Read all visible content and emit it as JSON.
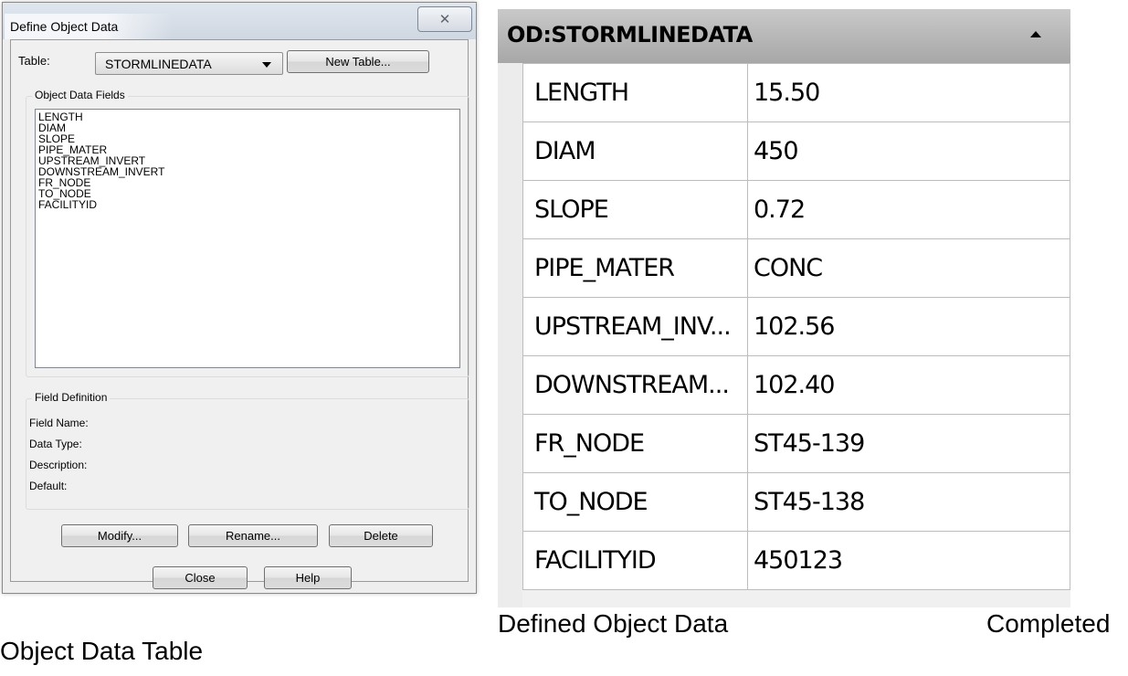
{
  "dialog": {
    "title": "Define Object Data",
    "close_glyph": "✕",
    "table_label": "Table:",
    "table_value": "STORMLINEDATA",
    "new_table_button": "New Table...",
    "fields_group_label": "Object Data Fields",
    "fields": [
      "LENGTH",
      "DIAM",
      "SLOPE",
      "PIPE_MATER",
      "UPSTREAM_INVERT",
      "DOWNSTREAM_INVERT",
      "FR_NODE",
      "TO_NODE",
      "FACILITYID"
    ],
    "definition_group_label": "Field Definition",
    "field_name_label": "Field Name:",
    "data_type_label": "Data Type:",
    "description_label": "Description:",
    "default_label": "Default:",
    "modify_button": "Modify...",
    "rename_button": "Rename...",
    "delete_button": "Delete",
    "close_button": "Close",
    "help_button": "Help"
  },
  "od_panel": {
    "title": "OD:STORMLINEDATA",
    "collapse_icon": "caret-up-icon",
    "rows": [
      {
        "field": "LENGTH",
        "value": "15.50"
      },
      {
        "field": "DIAM",
        "value": "450"
      },
      {
        "field": "SLOPE",
        "value": "0.72"
      },
      {
        "field": "PIPE_MATER",
        "value": "CONC"
      },
      {
        "field": "UPSTREAM_INV...",
        "value": "102.56"
      },
      {
        "field": "DOWNSTREAM...",
        "value": "102.40"
      },
      {
        "field": "FR_NODE",
        "value": "ST45-139"
      },
      {
        "field": "TO_NODE",
        "value": "ST45-138"
      },
      {
        "field": "FACILITYID",
        "value": "450123"
      }
    ]
  },
  "captions": {
    "left": "Object Data Table",
    "middle": "Defined Object Data",
    "right": "Completed"
  }
}
